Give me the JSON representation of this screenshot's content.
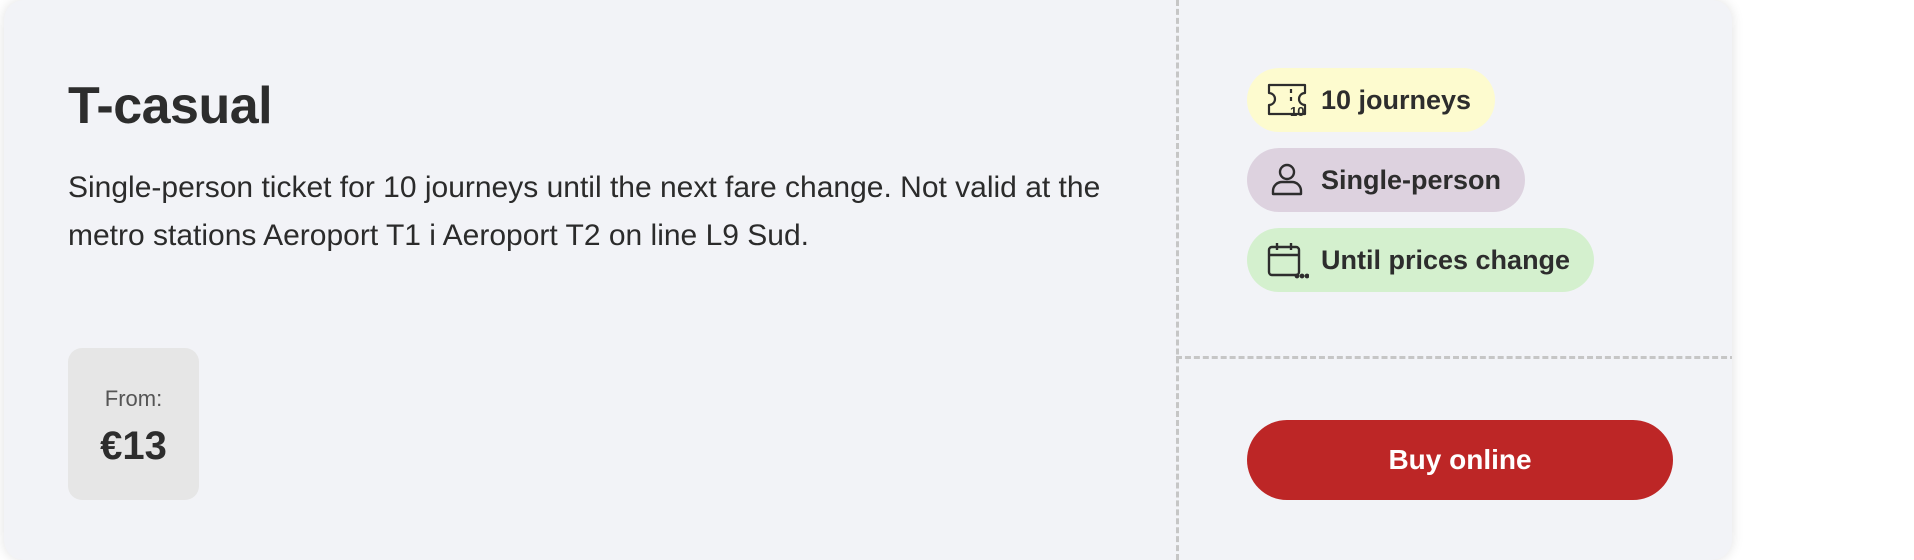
{
  "ticket": {
    "title": "T-casual",
    "description": "Single-person ticket for 10 journeys until the next fare change. Not valid at the metro stations Aeroport T1 i Aeroport T2 on line L9 Sud.",
    "price_label": "From:",
    "price_value": "€13"
  },
  "tags": [
    {
      "label": "10 journeys",
      "icon": "ticket-10-icon",
      "color": "#fdfbcf"
    },
    {
      "label": "Single-person",
      "icon": "person-icon",
      "color": "#ddd2df"
    },
    {
      "label": "Until prices change",
      "icon": "calendar-icon",
      "color": "#d4f0ce"
    }
  ],
  "actions": {
    "buy_label": "Buy online",
    "buy_color": "#bd2626"
  }
}
